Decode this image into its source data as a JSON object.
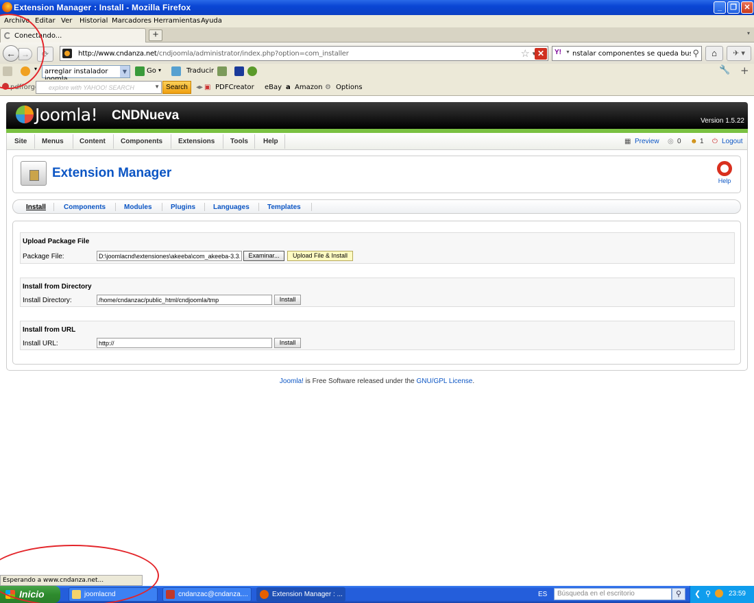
{
  "window": {
    "title": "Extension Manager : Install - Mozilla Firefox"
  },
  "menubar": [
    "Archivo",
    "Editar",
    "Ver",
    "Historial",
    "Marcadores",
    "Herramientas",
    "Ayuda"
  ],
  "tab": {
    "label": "Conectando..."
  },
  "url": {
    "host": "http://www.cndanza.net",
    "path": "/cndjoomla/administrator/index.php?option=com_installer"
  },
  "search": {
    "query": "nstalar componentes se queda buscando",
    "engine": "Y!"
  },
  "toolbar2": {
    "select_value": "arreglar instalador joomla",
    "go": "Go",
    "translate": "Traducir"
  },
  "toolbar3": {
    "brand": "pdfforge",
    "search_placeholder": "explore with YAHOO! SEARCH",
    "search_button": "Search",
    "items": [
      "PDFCreator",
      "eBay",
      "Amazon",
      "Options"
    ]
  },
  "joomla": {
    "logo": "Joomla!",
    "site_name": "CNDNueva",
    "version": "Version 1.5.22",
    "menu": [
      "Site",
      "Menus",
      "Content",
      "Components",
      "Extensions",
      "Tools",
      "Help"
    ],
    "right_menu": {
      "preview": "Preview",
      "messages": "0",
      "users": "1",
      "logout": "Logout"
    },
    "page_title": "Extension Manager",
    "help": "Help",
    "subnav": [
      "Install",
      "Components",
      "Modules",
      "Plugins",
      "Languages",
      "Templates"
    ],
    "upload": {
      "legend": "Upload Package File",
      "label": "Package File:",
      "value": "D:\\joomlacnd\\extensiones\\akeeba\\com_akeeba-3.3.",
      "browse": "Examinar...",
      "submit": "Upload File & Install"
    },
    "directory": {
      "legend": "Install from Directory",
      "label": "Install Directory:",
      "value": "/home/cndanzac/public_html/cndjoomla/tmp",
      "submit": "Install"
    },
    "url_install": {
      "legend": "Install from URL",
      "label": "Install URL:",
      "value": "http://",
      "submit": "Install"
    },
    "footer": {
      "link1": "Joomla!",
      "text": " is Free Software released under the ",
      "link2": "GNU/GPL License",
      "end": "."
    }
  },
  "status": "Esperando a www.cndanza.net...",
  "taskbar": {
    "start": "Inicio",
    "tasks": [
      "joomlacnd",
      "cndanzac@cndanza....",
      "Extension Manager : ..."
    ],
    "lang": "ES",
    "search_placeholder": "Búsqueda en el escritorio",
    "clock": "23:59"
  },
  "colors": {
    "joomla_blue": "#0b55c4",
    "joomla_green": "#7ac142",
    "annotation_red": "#e3252a",
    "xp_blue": "#245edb"
  }
}
